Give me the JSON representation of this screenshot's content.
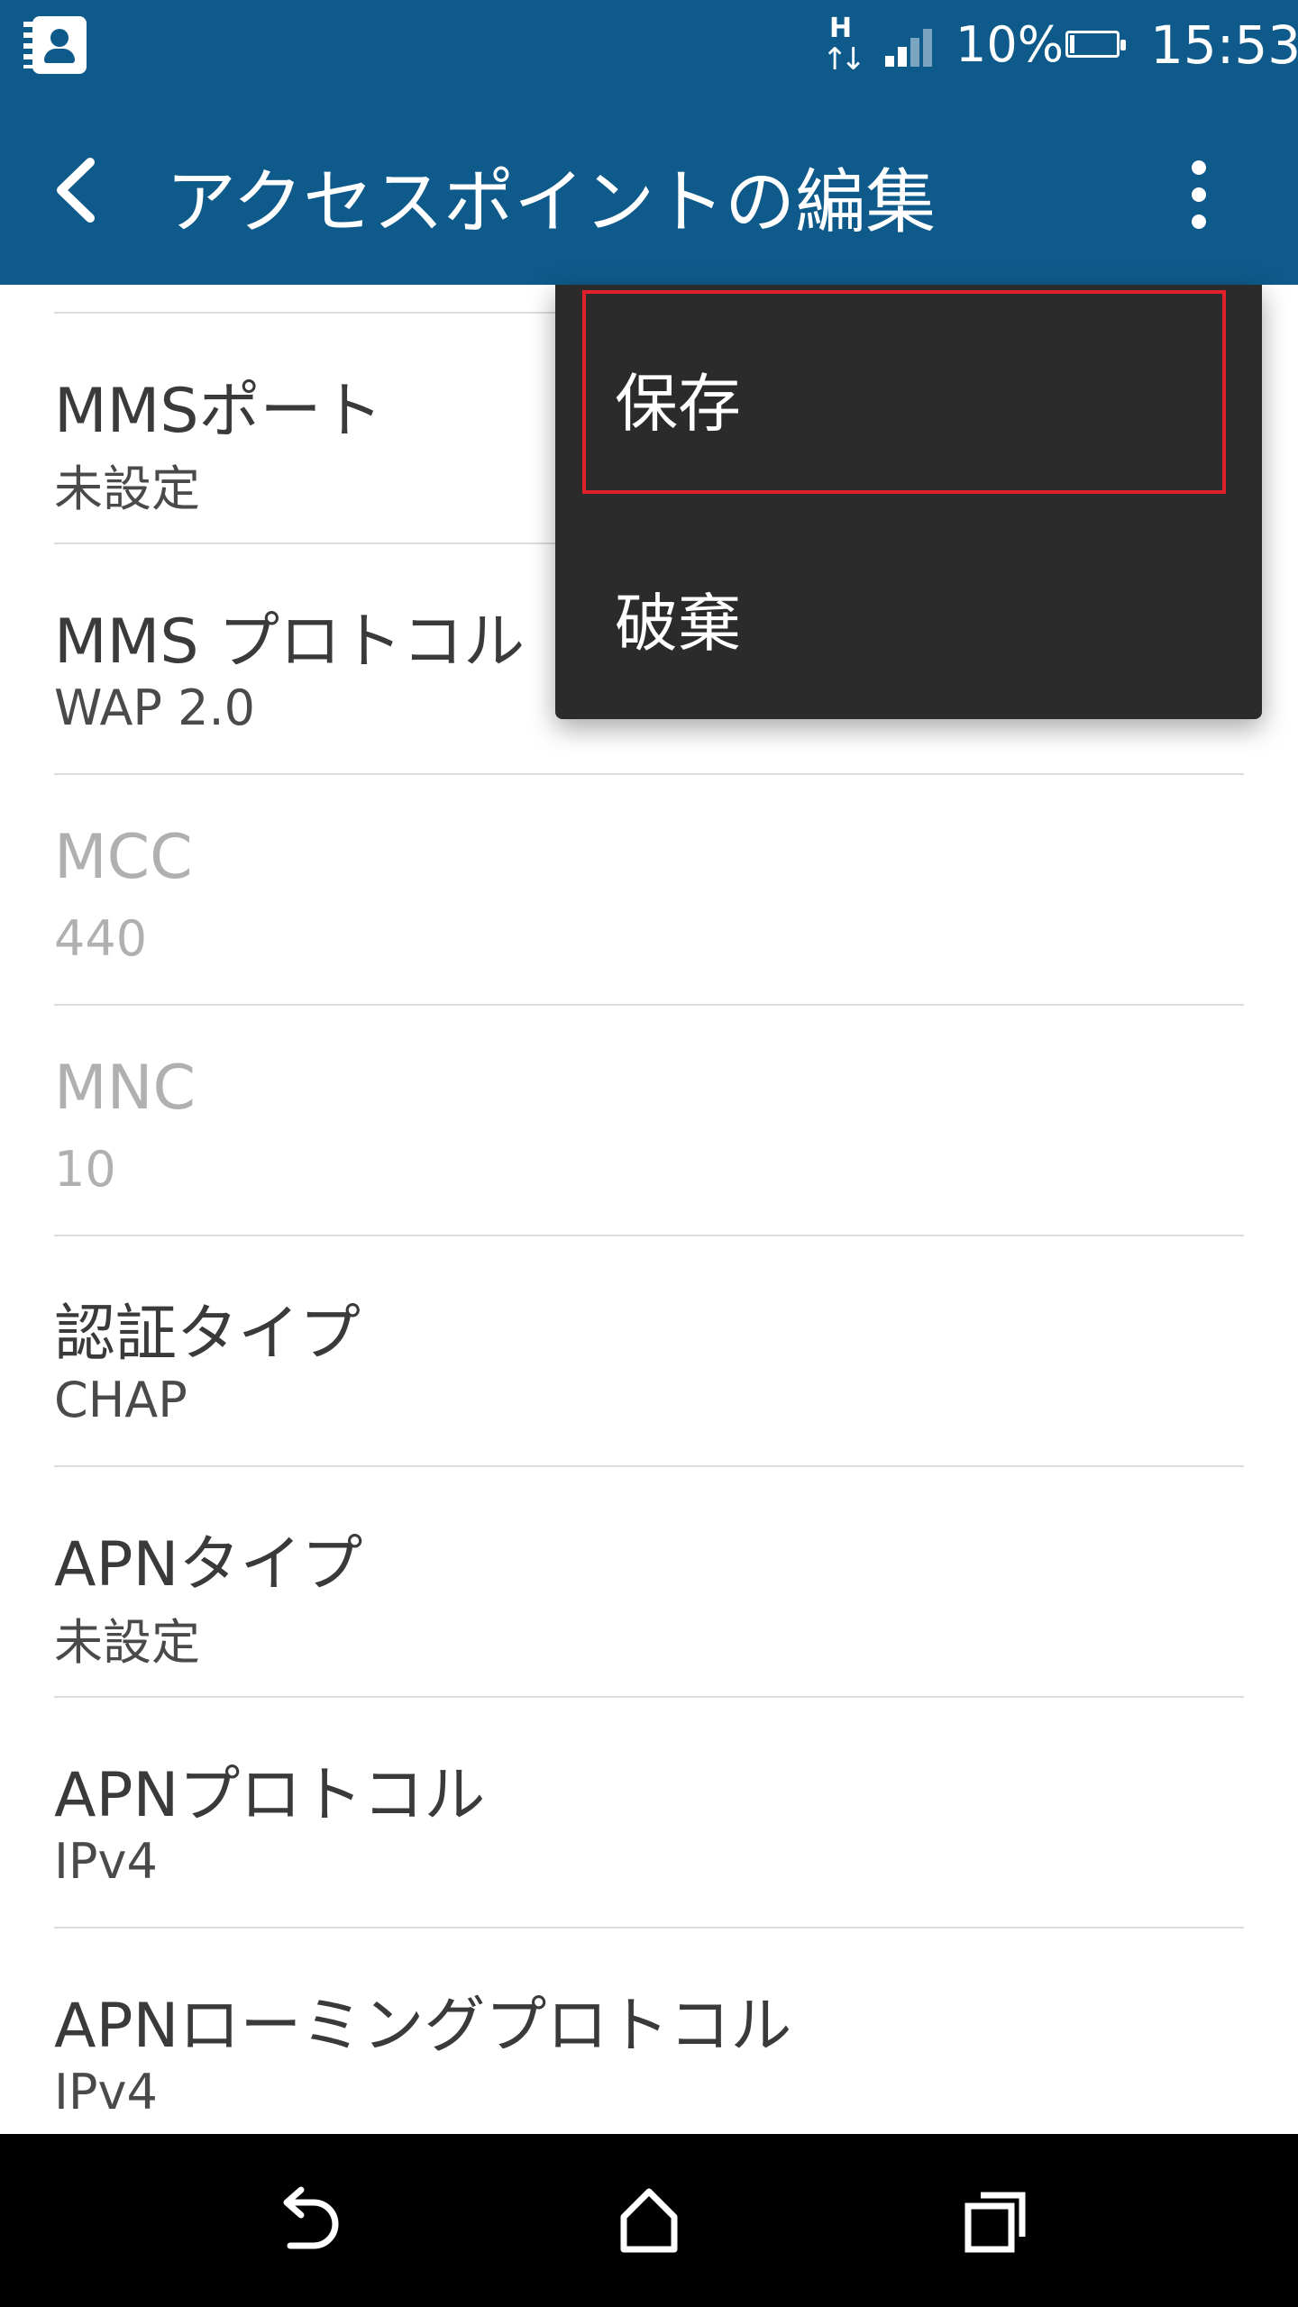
{
  "status_bar": {
    "network_label": "H",
    "battery_percent": "10%",
    "battery_level": 0.1,
    "time": "15:53"
  },
  "app_bar": {
    "title": "アクセスポイントの編集"
  },
  "settings": [
    {
      "title": "MMSポート",
      "value": "未設定",
      "enabled": true
    },
    {
      "title": "MMS プロトコル",
      "value": "WAP 2.0",
      "enabled": true
    },
    {
      "title": "MCC",
      "value": "440",
      "enabled": false
    },
    {
      "title": "MNC",
      "value": "10",
      "enabled": false
    },
    {
      "title": "認証タイプ",
      "value": "CHAP",
      "enabled": true
    },
    {
      "title": "APNタイプ",
      "value": "未設定",
      "enabled": true
    },
    {
      "title": "APNプロトコル",
      "value": "IPv4",
      "enabled": true
    },
    {
      "title": "APNローミングプロトコル",
      "value": "IPv4",
      "enabled": true
    }
  ],
  "menu": {
    "save_label": "保存",
    "discard_label": "破棄"
  },
  "colors": {
    "app_bar": "#0e5a8a",
    "highlight": "#e0202a",
    "menu_bg": "#2b2b2b"
  }
}
